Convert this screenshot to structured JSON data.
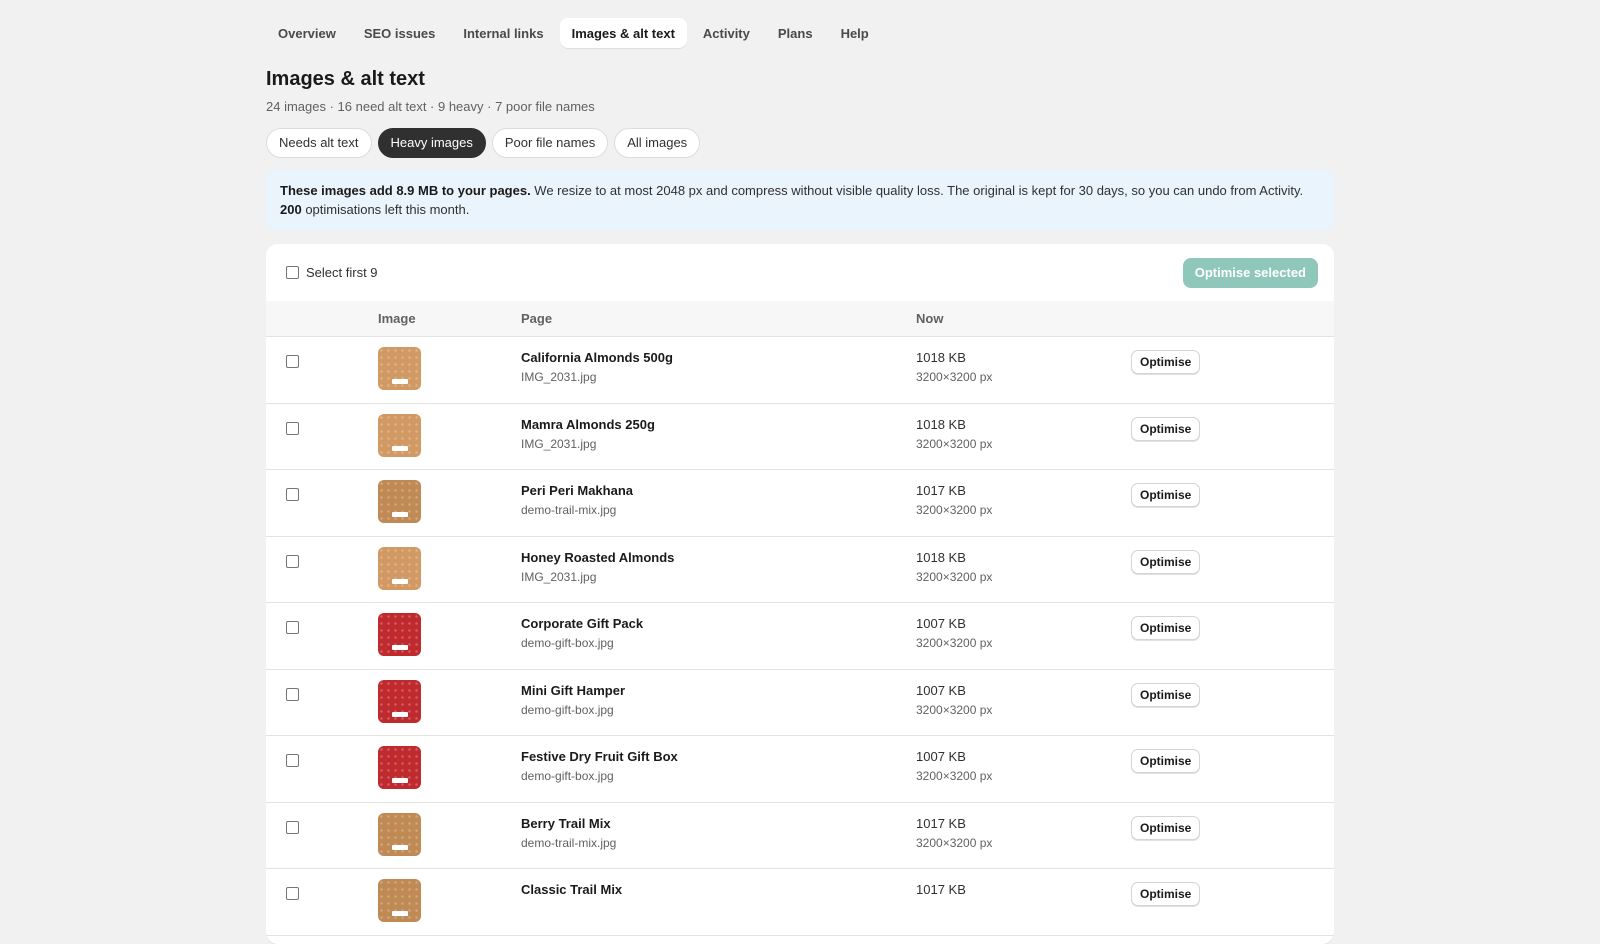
{
  "nav": {
    "tabs": [
      {
        "label": "Overview",
        "active": false
      },
      {
        "label": "SEO issues",
        "active": false
      },
      {
        "label": "Internal links",
        "active": false
      },
      {
        "label": "Images & alt text",
        "active": true
      },
      {
        "label": "Activity",
        "active": false
      },
      {
        "label": "Plans",
        "active": false
      },
      {
        "label": "Help",
        "active": false
      }
    ]
  },
  "header": {
    "title": "Images & alt text",
    "subtitle": "24 images · 16 need alt text · 9 heavy · 7 poor file names"
  },
  "filters": [
    {
      "label": "Needs alt text",
      "active": false
    },
    {
      "label": "Heavy images",
      "active": true
    },
    {
      "label": "Poor file names",
      "active": false
    },
    {
      "label": "All images",
      "active": false
    }
  ],
  "banner": {
    "bold_lead": "These images add 8.9 MB to your pages.",
    "text": " We resize to at most 2048 px and compress without visible quality loss. The original is kept for 30 days, so you can undo from Activity. ",
    "count": "200",
    "count_suffix": " optimisations left this month."
  },
  "table": {
    "select_all_label": "Select first 9",
    "bulk_action_label": "Optimise selected",
    "columns": {
      "image": "Image",
      "page": "Page",
      "now": "Now"
    },
    "rows": [
      {
        "title": "California Almonds 500g",
        "file": "IMG_2031.jpg",
        "size": "1018 KB",
        "dims": "3200×3200 px",
        "action": "Optimise",
        "thumb_color": "#d19a64"
      },
      {
        "title": "Mamra Almonds 250g",
        "file": "IMG_2031.jpg",
        "size": "1018 KB",
        "dims": "3200×3200 px",
        "action": "Optimise",
        "thumb_color": "#d19a64"
      },
      {
        "title": "Peri Peri Makhana",
        "file": "demo-trail-mix.jpg",
        "size": "1017 KB",
        "dims": "3200×3200 px",
        "action": "Optimise",
        "thumb_color": "#c08a55"
      },
      {
        "title": "Honey Roasted Almonds",
        "file": "IMG_2031.jpg",
        "size": "1018 KB",
        "dims": "3200×3200 px",
        "action": "Optimise",
        "thumb_color": "#d19a64"
      },
      {
        "title": "Corporate Gift Pack",
        "file": "demo-gift-box.jpg",
        "size": "1007 KB",
        "dims": "3200×3200 px",
        "action": "Optimise",
        "thumb_color": "#bf2a2e"
      },
      {
        "title": "Mini Gift Hamper",
        "file": "demo-gift-box.jpg",
        "size": "1007 KB",
        "dims": "3200×3200 px",
        "action": "Optimise",
        "thumb_color": "#bf2a2e"
      },
      {
        "title": "Festive Dry Fruit Gift Box",
        "file": "demo-gift-box.jpg",
        "size": "1007 KB",
        "dims": "3200×3200 px",
        "action": "Optimise",
        "thumb_color": "#bf2a2e"
      },
      {
        "title": "Berry Trail Mix",
        "file": "demo-trail-mix.jpg",
        "size": "1017 KB",
        "dims": "3200×3200 px",
        "action": "Optimise",
        "thumb_color": "#c08a55"
      },
      {
        "title": "Classic Trail Mix",
        "file": "",
        "size": "1017 KB",
        "dims": "",
        "action": "Optimise",
        "thumb_color": "#c08a55"
      }
    ]
  }
}
